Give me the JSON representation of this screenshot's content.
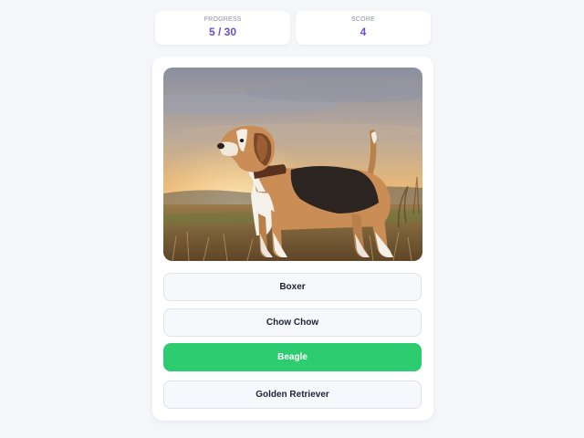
{
  "stats": {
    "progress": {
      "label": "PROGRESS",
      "current": "5",
      "separator": "/",
      "total": "30"
    },
    "score": {
      "label": "SCORE",
      "value": "4"
    }
  },
  "question": {
    "image": {
      "subject": "beagle dog standing in field at sunset"
    }
  },
  "answers": [
    {
      "label": "Boxer",
      "state": "default"
    },
    {
      "label": "Chow Chow",
      "state": "default"
    },
    {
      "label": "Beagle",
      "state": "correct"
    },
    {
      "label": "Golden Retriever",
      "state": "default"
    }
  ],
  "colors": {
    "accent": "#6a4fc8",
    "correct": "#2ecc71",
    "background": "#f4f6fa",
    "card": "#ffffff"
  }
}
